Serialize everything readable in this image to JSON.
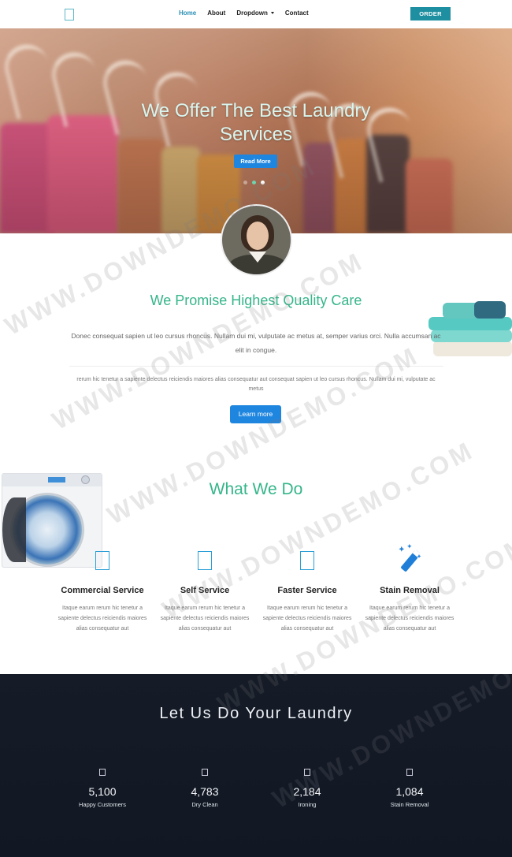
{
  "nav": {
    "links": [
      {
        "label": "Home",
        "active": true
      },
      {
        "label": "About",
        "active": false
      },
      {
        "label": "Dropdown",
        "active": false,
        "dropdown": true
      },
      {
        "label": "Contact",
        "active": false
      }
    ],
    "order_label": "ORDER"
  },
  "hero": {
    "title_line1": "We Offer The Best Laundry",
    "title_line2": "Services",
    "button_label": "Read More",
    "slides": 3,
    "active_slide": 3
  },
  "promise": {
    "title": "We Promise Highest Quality Care",
    "text": "Donec consequat sapien ut leo cursus rhoncus. Nullam dui mi, vulputate ac metus at, semper varius orci. Nulla accumsan ac elit in congue.",
    "subtext": "rerum hic tenetur a sapiente delectus reiciendis maiores alias consequatur aut consequat sapien ut leo cursus rhoncus. Nullam dui mi, vulputate ac metus",
    "button_label": "Learn more"
  },
  "services": {
    "title": "What We Do",
    "items": [
      {
        "name": "Commercial Service",
        "icon": "document-icon",
        "desc": "Itaque earum rerum hic tenetur a sapiente delectus reiciendis maiores alias consequatur aut"
      },
      {
        "name": "Self Service",
        "icon": "document-icon",
        "desc": "Itaque earum rerum hic tenetur a sapiente delectus reiciendis maiores alias consequatur aut"
      },
      {
        "name": "Faster Service",
        "icon": "document-icon",
        "desc": "Itaque earum rerum hic tenetur a sapiente delectus reiciendis maiores alias consequatur aut"
      },
      {
        "name": "Stain Removal",
        "icon": "magic-wand-icon",
        "desc": "Itaque earum rerum hic tenetur a sapiente delectus reiciendis maiores alias consequatur aut"
      }
    ]
  },
  "stats": {
    "title": "Let Us Do Your Laundry",
    "items": [
      {
        "value": "5,100",
        "label": "Happy Customers"
      },
      {
        "value": "4,783",
        "label": "Dry Clean"
      },
      {
        "value": "2,184",
        "label": "Ironing"
      },
      {
        "value": "1,084",
        "label": "Stain Removal"
      }
    ]
  },
  "watermark": "WWW.DOWNDEMO.COM",
  "colors": {
    "accent_green": "#35b58a",
    "primary_blue": "#1f86e0",
    "order_teal": "#1d8fa0",
    "nav_active": "#2b8fb5",
    "dark_bg": "#141a25"
  }
}
